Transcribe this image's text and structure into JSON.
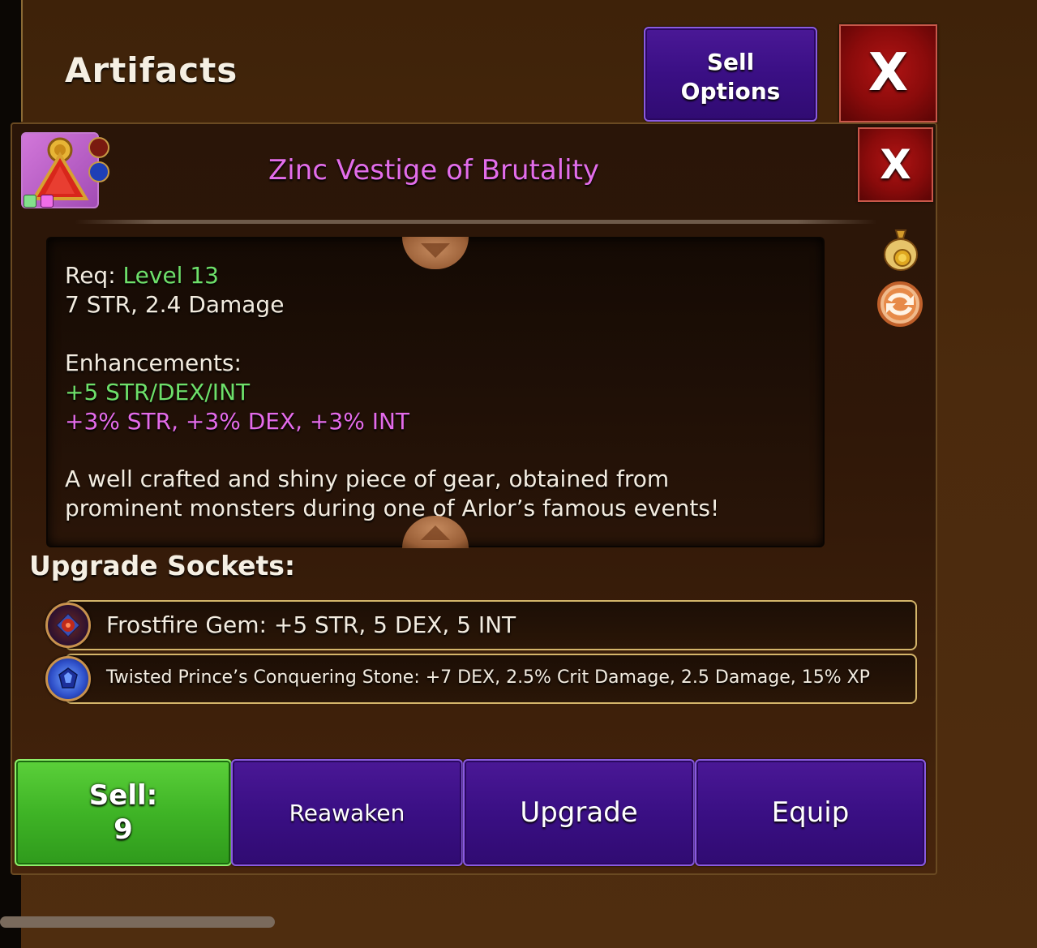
{
  "header": {
    "title": "Artifacts",
    "sell_options_line1": "Sell",
    "sell_options_line2": "Options",
    "close_label": "X"
  },
  "item": {
    "name": "Zinc Vestige of Brutality",
    "close_label": "X",
    "name_color": "#e36dea",
    "icon": "red-triangle-amulet-icon",
    "attached_gems": [
      "frostfire-gem-icon",
      "conquering-stone-icon"
    ],
    "rarity_dots": [
      "#84e08c",
      "#f06de8"
    ]
  },
  "details": {
    "req_label": "Req:",
    "req_value": "Level 13",
    "base_stats": "7 STR, 2.4 Damage",
    "enhancements_label": "Enhancements:",
    "enhancement_green": "+5 STR/DEX/INT",
    "enhancement_pink": "+3% STR, +3% DEX, +3% INT",
    "description_line1": "A well crafted and shiny piece of gear, obtained from",
    "description_line2": "prominent monsters during one of Arlor’s famous events!"
  },
  "side_icons": [
    "gold-bag-icon",
    "swap-icon"
  ],
  "sockets": {
    "title": "Upgrade Sockets:",
    "items": [
      {
        "text": "Frostfire Gem: +5 STR, 5 DEX, 5 INT",
        "icon": "frostfire-gem-icon"
      },
      {
        "text": "Twisted Prince’s Conquering Stone: +7 DEX, 2.5% Crit Damage, 2.5 Damage, 15% XP",
        "icon": "conquering-stone-icon"
      }
    ]
  },
  "actions": {
    "sell_label": "Sell:",
    "sell_value": "9",
    "reawaken": "Reawaken",
    "upgrade": "Upgrade",
    "equip": "Equip"
  },
  "colors": {
    "level_green": "#6ee06a",
    "enhance_pink": "#e46bea",
    "sell_green": "#3fb426",
    "button_purple": "#3a0f84",
    "close_red": "#8a0b0b"
  }
}
